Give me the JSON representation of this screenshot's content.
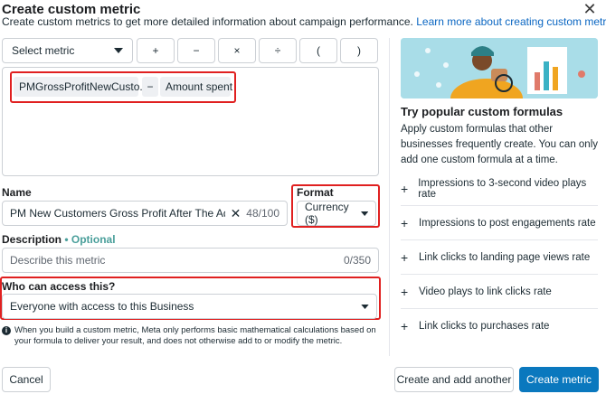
{
  "dialog": {
    "title": "Create custom metric",
    "subtitle": "Create custom metrics to get more detailed information about campaign performance.",
    "learn_more": "Learn more about creating custom metrics",
    "close_glyph": "✕"
  },
  "toolbar": {
    "select_metric": "Select metric",
    "operators": [
      "+",
      "−",
      "×",
      "÷",
      "(",
      ")"
    ]
  },
  "formula": {
    "chips": [
      "PMGrossProfitNewCusto...",
      "−",
      "Amount spent"
    ]
  },
  "name": {
    "label": "Name",
    "value": "PM New Customers Gross Profit After The Ad Spend",
    "counter": "48/100"
  },
  "format": {
    "label": "Format",
    "value": "Currency ($)"
  },
  "description": {
    "label": "Description",
    "optional": "• Optional",
    "placeholder": "Describe this metric",
    "counter": "0/350"
  },
  "access": {
    "label": "Who can access this?",
    "value": "Everyone with access to this Business"
  },
  "info": "When you build a custom metric, Meta only performs basic mathematical calculations based on your formula to deliver your result, and does not otherwise add to or modify the metric.",
  "popular": {
    "title": "Try popular custom formulas",
    "description": "Apply custom formulas that other businesses frequently create. You can only add one custom formula at a time.",
    "items": [
      "Impressions to 3-second video plays rate",
      "Impressions to post engagements rate",
      "Link clicks to landing page views rate",
      "Video plays to link clicks rate",
      "Link clicks to purchases rate"
    ]
  },
  "footer": {
    "cancel": "Cancel",
    "create_another": "Create and add another",
    "create": "Create metric"
  },
  "colors": {
    "primary": "#0a78be",
    "highlight": "#e02020",
    "optional": "#4a9f9b"
  }
}
